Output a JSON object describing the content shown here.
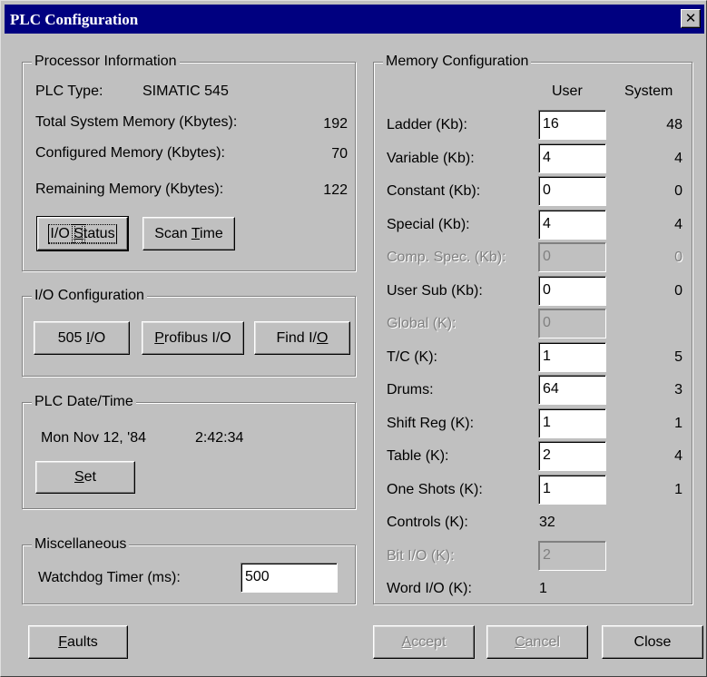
{
  "window": {
    "title": "PLC Configuration",
    "close_glyph": "✕"
  },
  "processor": {
    "legend": "Processor Information",
    "plc_type_label": "PLC Type:",
    "plc_type_value": "SIMATIC 545",
    "total_label": "Total System Memory (Kbytes):",
    "total_value": "192",
    "configured_label": "Configured Memory (Kbytes):",
    "configured_value": "70",
    "remaining_label": "Remaining Memory (Kbytes):",
    "remaining_value": "122",
    "io_status_button": {
      "pre": "I/O ",
      "key": "S",
      "post": "tatus"
    },
    "scan_time_button": {
      "pre": "Scan ",
      "key": "T",
      "post": "ime"
    }
  },
  "io_config": {
    "legend": "I/O Configuration",
    "btn_505": {
      "pre": "505 ",
      "key": "I",
      "post": "/O"
    },
    "btn_profibus": {
      "pre": "",
      "key": "P",
      "post": "rofibus I/O"
    },
    "btn_find": {
      "pre": "Find I/",
      "key": "O",
      "post": ""
    }
  },
  "date_time": {
    "legend": "PLC Date/Time",
    "date": "Mon Nov 12, '84",
    "time": "2:42:34",
    "set_button": {
      "pre": "",
      "key": "S",
      "post": "et"
    }
  },
  "misc": {
    "legend": "Miscellaneous",
    "watchdog_label": "Watchdog Timer (ms):",
    "watchdog_value": "500"
  },
  "memory": {
    "legend": "Memory Configuration",
    "user_header": "User",
    "system_header": "System",
    "rows": [
      {
        "label": "Ladder (Kb):",
        "user": "16",
        "system": "48",
        "kind": "input"
      },
      {
        "label": "Variable (Kb):",
        "user": "4",
        "system": "4",
        "kind": "input"
      },
      {
        "label": "Constant (Kb):",
        "user": "0",
        "system": "0",
        "kind": "input"
      },
      {
        "label": "Special (Kb):",
        "user": "4",
        "system": "4",
        "kind": "input"
      },
      {
        "label": "Comp. Spec. (Kb):",
        "user": "0",
        "system": "0",
        "kind": "disabled"
      },
      {
        "label": "User Sub (Kb):",
        "user": "0",
        "system": "0",
        "kind": "input"
      },
      {
        "label": "Global (K):",
        "user": "0",
        "system": "",
        "kind": "disabled"
      },
      {
        "label": "T/C (K):",
        "user": "1",
        "system": "5",
        "kind": "input"
      },
      {
        "label": "Drums:",
        "user": "64",
        "system": "3",
        "kind": "input"
      },
      {
        "label": "Shift Reg (K):",
        "user": "1",
        "system": "1",
        "kind": "input"
      },
      {
        "label": "Table (K):",
        "user": "2",
        "system": "4",
        "kind": "input"
      },
      {
        "label": "One Shots (K):",
        "user": "1",
        "system": "1",
        "kind": "input"
      },
      {
        "label": "Controls (K):",
        "user": "32",
        "system": "",
        "kind": "text"
      },
      {
        "label": "Bit I/O (K):",
        "user": "2",
        "system": "",
        "kind": "disabled"
      },
      {
        "label": "Word I/O (K):",
        "user": "1",
        "system": "",
        "kind": "text"
      }
    ]
  },
  "footer": {
    "faults_button": {
      "pre": "",
      "key": "F",
      "post": "aults"
    },
    "accept_button": {
      "pre": "",
      "key": "A",
      "post": "ccept"
    },
    "cancel_button": {
      "pre": "",
      "key": "C",
      "post": "ancel"
    },
    "close_button": {
      "pre": "Close",
      "key": "",
      "post": ""
    }
  }
}
